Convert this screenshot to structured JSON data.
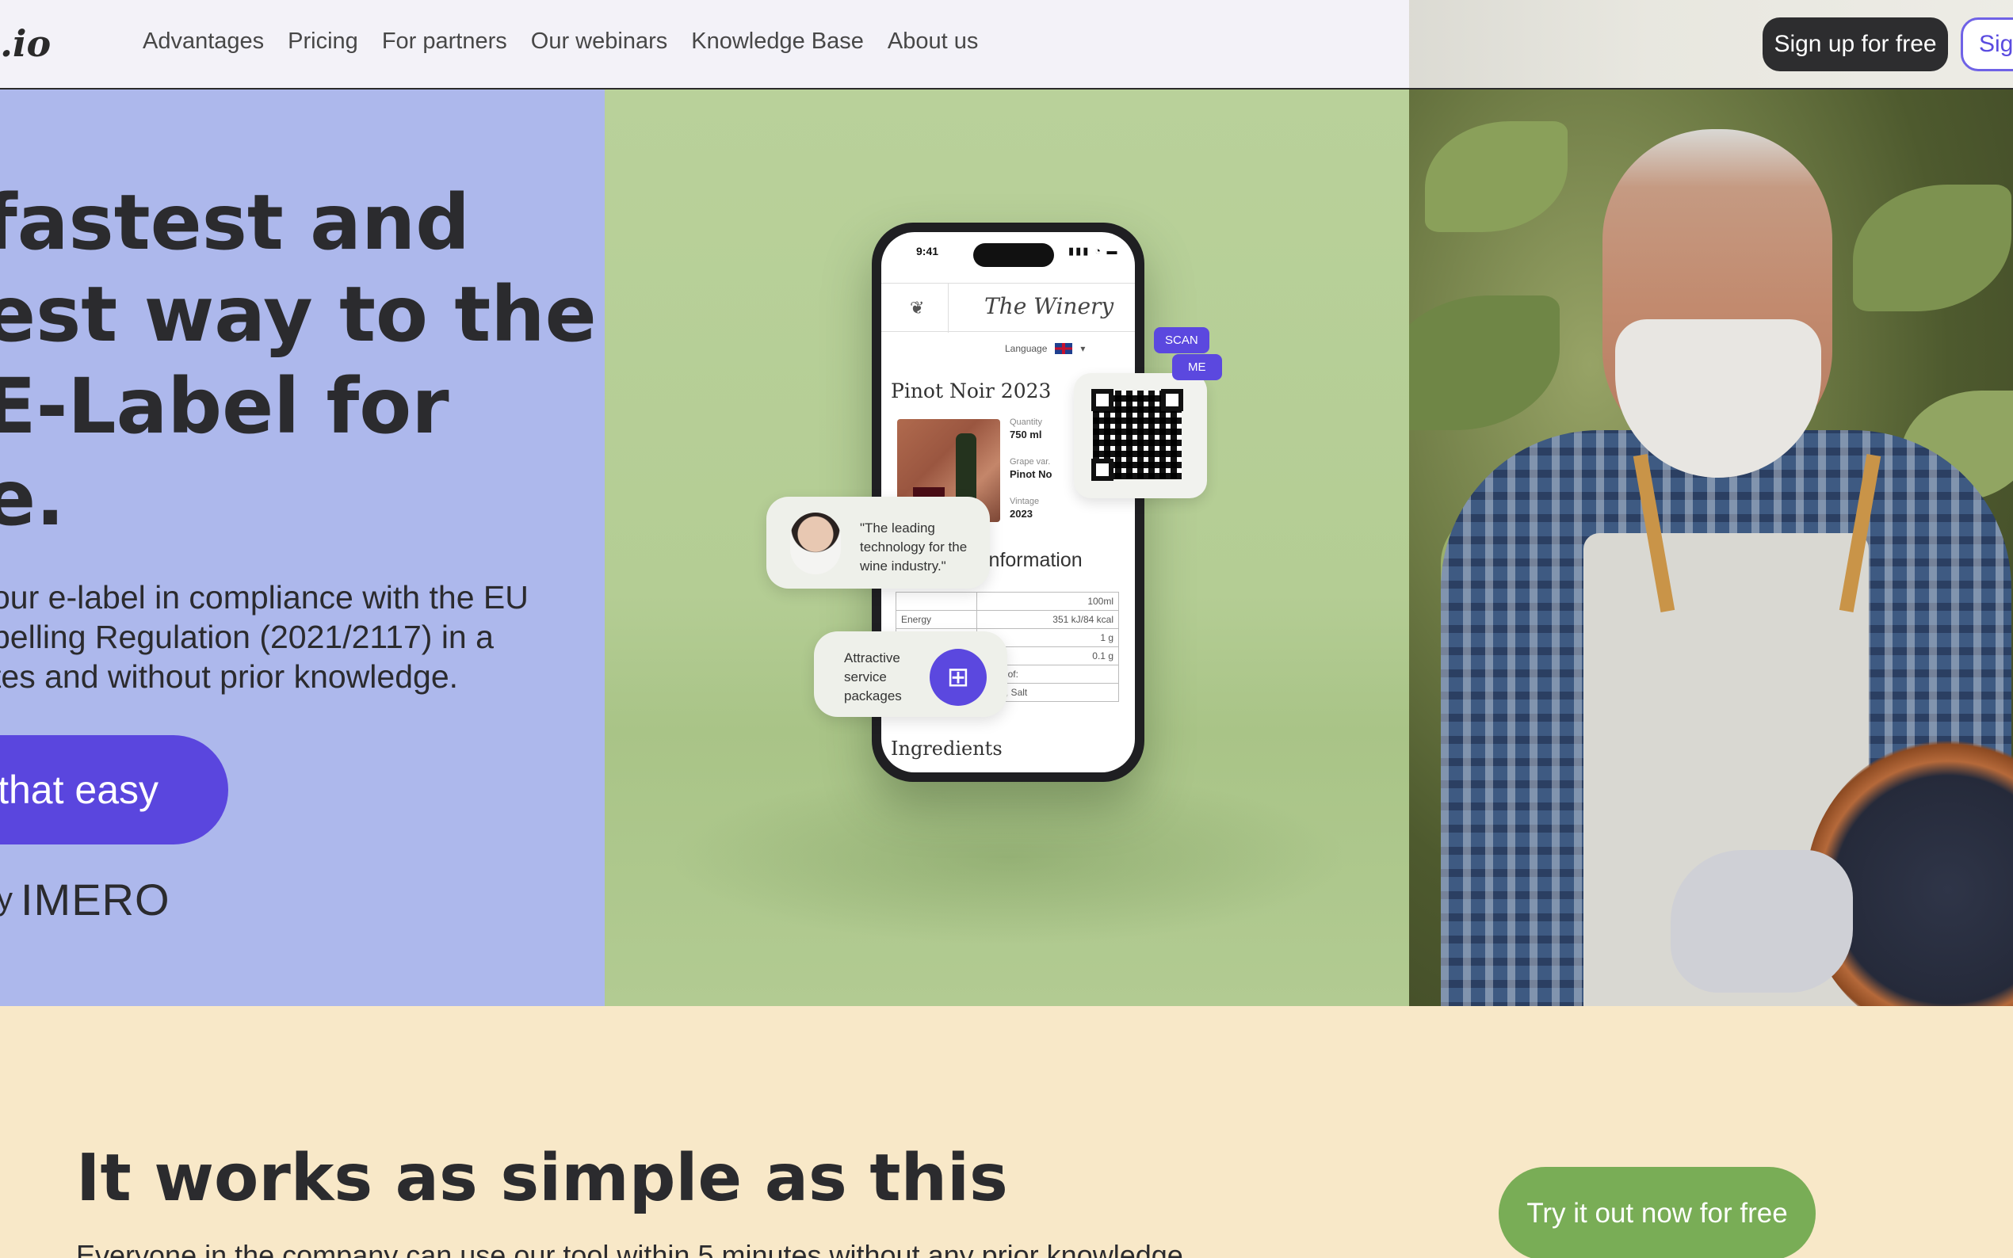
{
  "navbar": {
    "logo": ".io",
    "links": [
      "Advantages",
      "Pricing",
      "For partners",
      "Our webinars",
      "Knowledge Base",
      "About us"
    ],
    "signup_label": "Sign up for free",
    "signin_label": "Sign"
  },
  "hero": {
    "title_lines": [
      "fastest and",
      "est way to the",
      "E-Label for",
      "e."
    ],
    "subtitle_lines": [
      "our e-label in compliance with the EU",
      "pelling Regulation (2021/2117) in a",
      "tes and without prior knowledge."
    ],
    "cta_label": "that easy",
    "byline_prefix": "y",
    "brand": "IMERO"
  },
  "phone": {
    "time": "9:41",
    "status_icons": "▮▮▮ ◔ ▬",
    "winery": "The Winery",
    "language_label": "Language",
    "wine_title": "Pinot Noir 2023",
    "meta": [
      {
        "label": "Quantity",
        "value": "750 ml"
      },
      {
        "label": "Grape var.",
        "value": "Pinot No"
      },
      {
        "label": "Vintage",
        "value": "2023"
      }
    ],
    "info_title": "information",
    "nutrition_header": "100ml",
    "nutrition_rows": [
      {
        "label": "Energy",
        "value": "351 kJ/84 kcal"
      },
      {
        "label": "",
        "value": "1 g"
      },
      {
        "label": "",
        "value": "0.1 g"
      },
      {
        "label": "",
        "value": "ounts of:"
      },
      {
        "label": "",
        "value": "rotein, Salt"
      }
    ],
    "ingredients": "Ingredients"
  },
  "floating": {
    "scan": "SCAN",
    "me": "ME",
    "quote_lines": [
      "\"The leading",
      "technology for the",
      "wine industry.\""
    ],
    "service_lines": [
      "Attractive",
      "service",
      "packages"
    ]
  },
  "section2": {
    "title": "It works as simple as this",
    "subtitle": "Everyone in the company can use our tool within 5 minutes without any prior knowledge.",
    "try_label": "Try it out now for free"
  },
  "colors": {
    "hero_purple": "#adb8ec",
    "hero_green": "#b9d19a",
    "accent_purple": "#5a46de",
    "cta_green": "#79ad56",
    "section_bg": "#f8e8c8"
  }
}
